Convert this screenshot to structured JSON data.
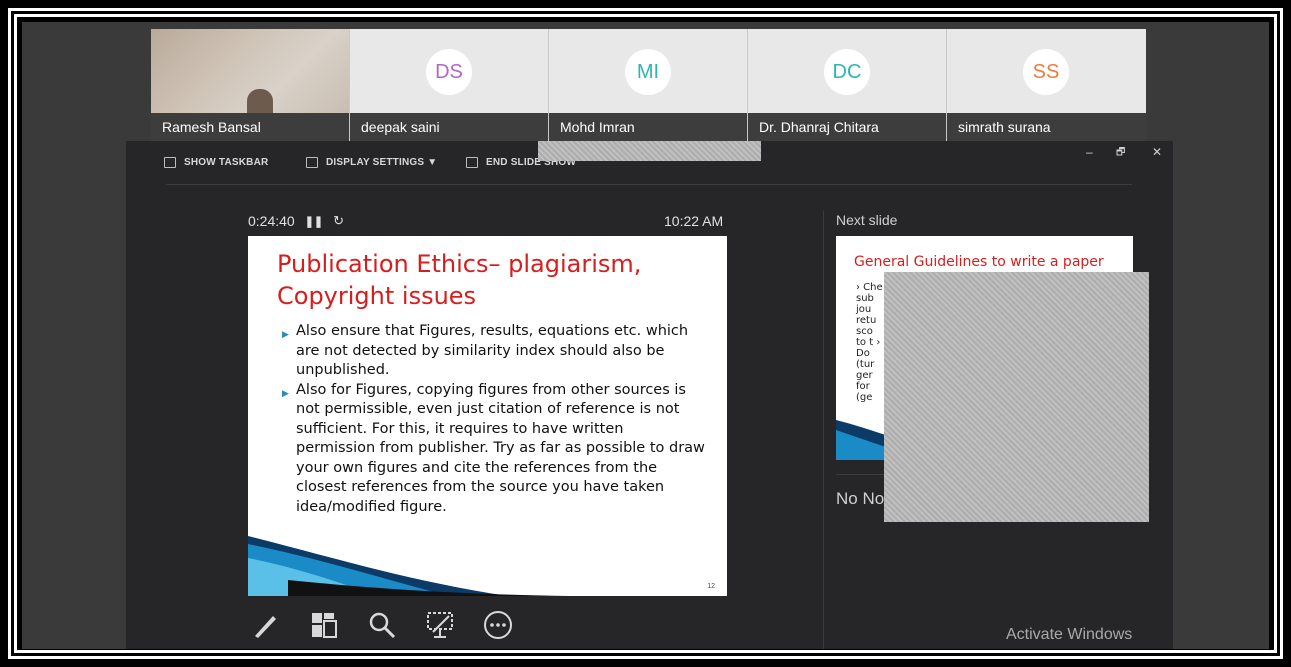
{
  "participants": [
    {
      "name": "Ramesh Bansal",
      "initials": "",
      "video": true
    },
    {
      "name": "deepak saini",
      "initials": "DS",
      "color": "#b565c7"
    },
    {
      "name": "Mohd Imran",
      "initials": "MI",
      "color": "#2eb6b0"
    },
    {
      "name": "Dr. Dhanraj Chitara",
      "initials": "DC",
      "color": "#2eb6b0"
    },
    {
      "name": "simrath surana",
      "initials": "SS",
      "color": "#f07a3a"
    }
  ],
  "toolbar": {
    "show_taskbar": "SHOW TASKBAR",
    "display_settings": "DISPLAY SETTINGS ▼",
    "end_slide_show": "END SLIDE SHOW",
    "minimize": "–",
    "restore": "🗗",
    "close": "✕"
  },
  "presenter": {
    "elapsed": "0:24:40",
    "pause_icon": "pause-icon",
    "reset_icon": "reset-icon",
    "clock": "10:22 AM"
  },
  "current_slide": {
    "title_line1": "Publication Ethics– plagiarism,",
    "title_line2": "Copyright issues",
    "bullets": [
      "Also ensure that Figures, results, equations etc. which are not detected by similarity index should also be unpublished.",
      "Also for Figures, copying figures from other sources is not permissible, even just citation of reference is not sufficient. For this, it requires to have written permission from publisher. Try as far as possible to draw your own figures and cite the references from the closest references from the source you have taken idea/modified figure."
    ],
    "slide_number": "12",
    "accent": "#d71e1e"
  },
  "next": {
    "label": "Next slide",
    "title": "General Guidelines to write a paper",
    "fragment": "› Che sub jou retu sco to t › Do (tur ger for (ge"
  },
  "notes": {
    "text": "No No"
  },
  "tools": [
    "pen-icon",
    "slide-grid-icon",
    "zoom-icon",
    "pointer-screen-icon",
    "more-icon"
  ],
  "watermark": "Activate Windows"
}
